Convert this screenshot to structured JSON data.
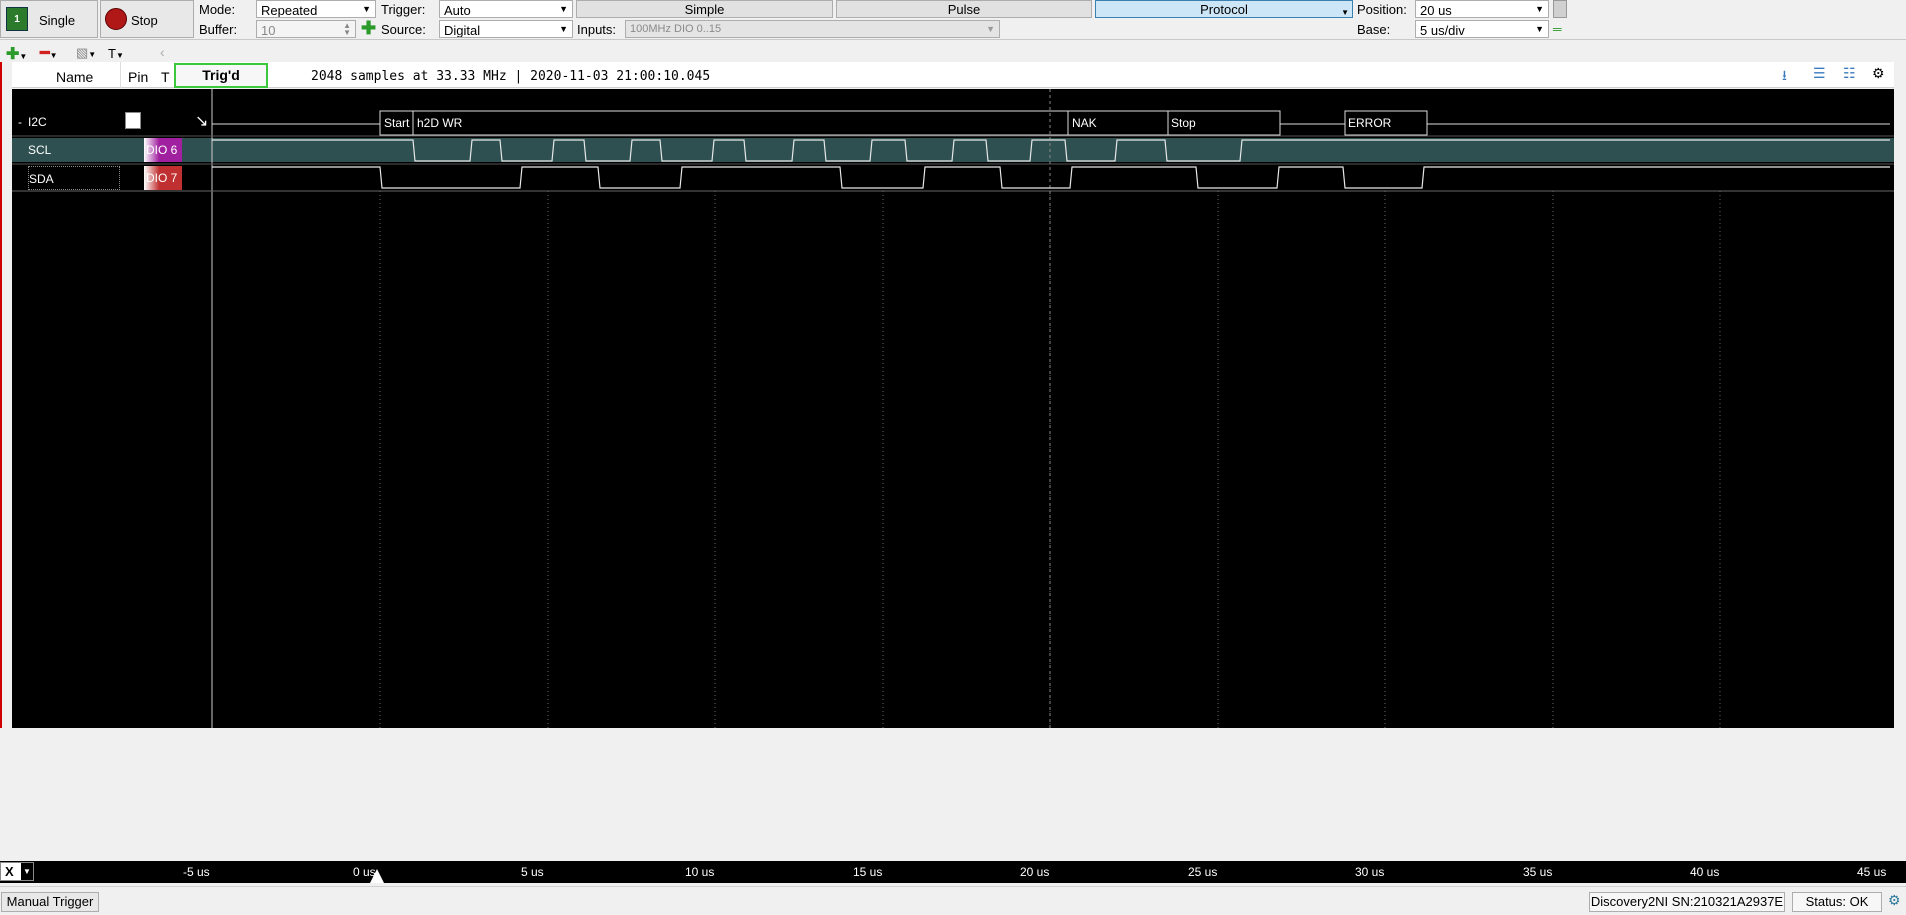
{
  "toolbar": {
    "single_label": "Single",
    "stop_label": "Stop",
    "mode_label": "Mode:",
    "mode_value": "Repeated",
    "buffer_label": "Buffer:",
    "buffer_value": "10",
    "trigger_label": "Trigger:",
    "trigger_value": "Auto",
    "source_label": "Source:",
    "source_value": "Digital",
    "trigger_tabs": [
      "Simple",
      "Pulse",
      "Protocol"
    ],
    "inputs_label": "Inputs:",
    "inputs_value": "100MHz DIO 0..15",
    "position_label": "Position:",
    "position_value": "20 us",
    "base_label": "Base:",
    "base_value": "5 us/div"
  },
  "subtoolbar": {
    "add_icon": "plus-icon",
    "remove_icon": "minus-icon",
    "edit_icon": "pencil-icon",
    "text_label": "T"
  },
  "table": {
    "col_name": "Name",
    "col_pin": "Pin",
    "col_trigger": "T",
    "trig_status": "Trig'd",
    "info": "2048 samples at 33.33 MHz | 2020-11-03 21:00:10.045"
  },
  "channels": [
    {
      "name": "I2C",
      "prefix": "-",
      "pin": "",
      "trigger": "falling-edge"
    },
    {
      "name": "SCL",
      "pin": "DIO 6"
    },
    {
      "name": "SDA",
      "pin": "DIO 7"
    }
  ],
  "decode": {
    "start": "Start",
    "address": "h2D WR",
    "nak": "NAK",
    "stop": "Stop",
    "error": "ERROR"
  },
  "axis": {
    "ticks": [
      "-5 us",
      "0 us",
      "5 us",
      "10 us",
      "15 us",
      "20 us",
      "25 us",
      "30 us",
      "35 us",
      "40 us",
      "45 us"
    ]
  },
  "status": {
    "manual_trigger": "Manual Trigger",
    "device": "Discovery2NI SN:210321A2937E",
    "status": "Status: OK"
  },
  "colors": {
    "plot_bg": "#000000",
    "scl_row": "#2f5050",
    "protocol_active": "#cde6f7",
    "dio6_badge": "#a020a0",
    "dio7_badge": "#c03030",
    "trig_border": "#3cc83c"
  }
}
